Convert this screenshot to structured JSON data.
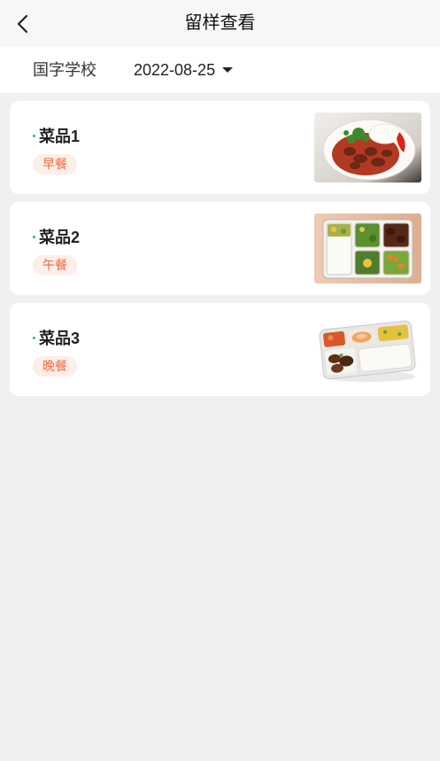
{
  "header": {
    "title": "留样查看",
    "back_icon": "chevron-left-icon"
  },
  "filter": {
    "school": "国字学校",
    "date": "2022-08-25",
    "dropdown_icon": "caret-down-icon"
  },
  "dishes": [
    {
      "name": "菜品1",
      "meal": "早餐"
    },
    {
      "name": "菜品2",
      "meal": "午餐"
    },
    {
      "name": "菜品3",
      "meal": "晚餐"
    }
  ],
  "colors": {
    "accent": "#2bb673",
    "tag_text": "#f0683c",
    "tag_bg": "#fdeee8",
    "page_bg": "#f0f0f0"
  }
}
